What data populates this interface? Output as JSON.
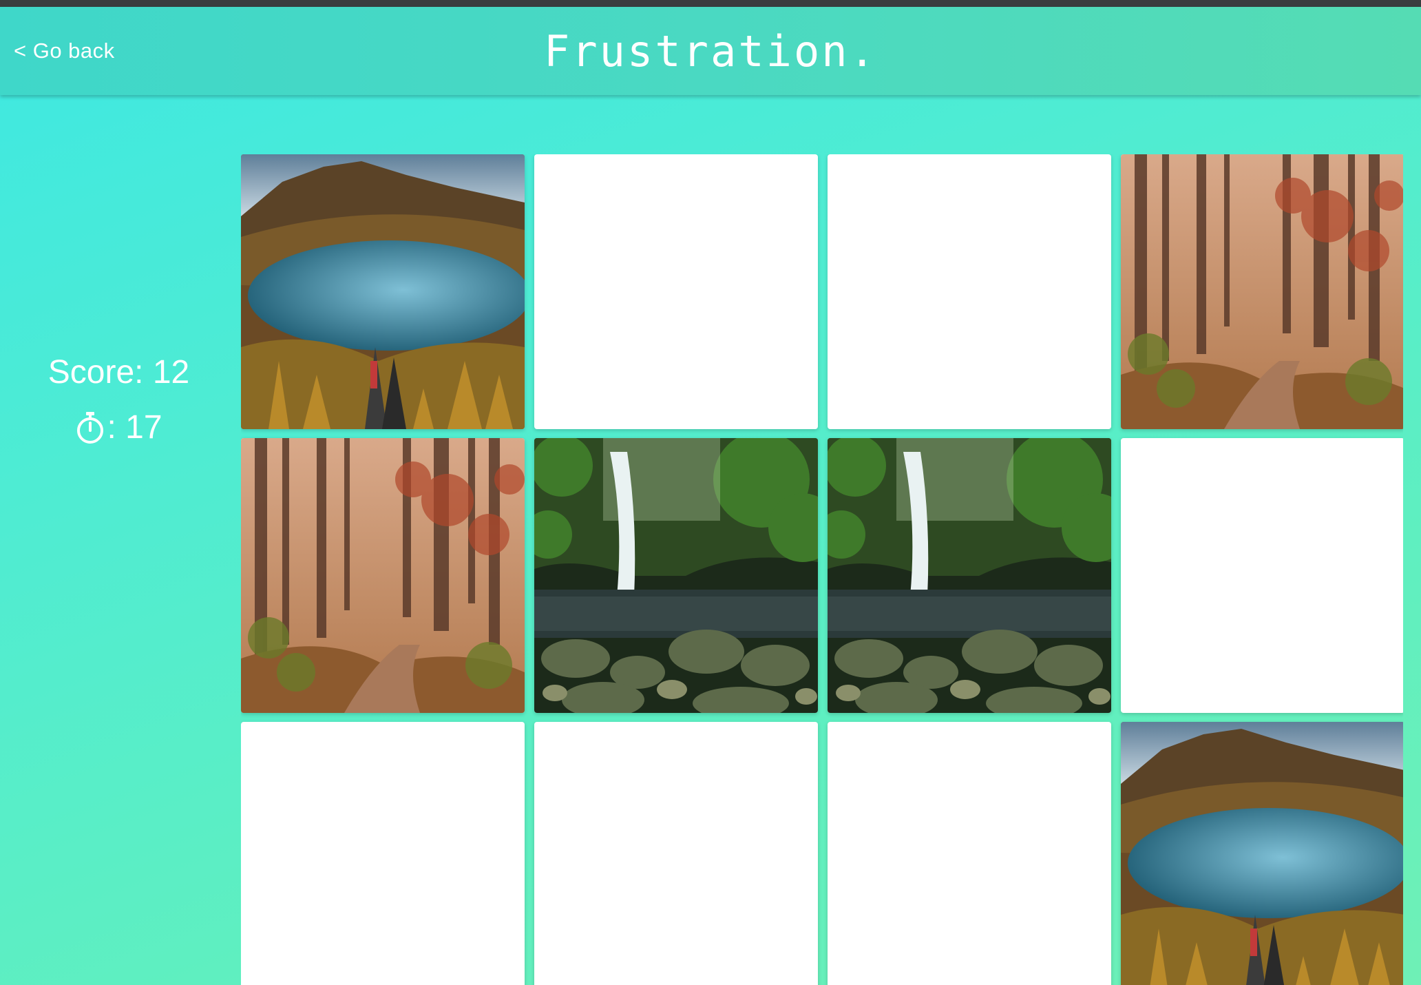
{
  "header": {
    "back_label": "< Go back",
    "title": "Frustration."
  },
  "stats": {
    "score_label": "Score: 12",
    "timer_label": ": 17",
    "timer_icon": "stopwatch-icon"
  },
  "board": {
    "rows": 3,
    "cols": 4,
    "cards": [
      {
        "state": "revealed",
        "image": "mountain-lake"
      },
      {
        "state": "hidden",
        "image": ""
      },
      {
        "state": "hidden",
        "image": ""
      },
      {
        "state": "revealed",
        "image": "autumn-forest"
      },
      {
        "state": "revealed",
        "image": "autumn-forest"
      },
      {
        "state": "revealed",
        "image": "waterfall"
      },
      {
        "state": "revealed",
        "image": "waterfall"
      },
      {
        "state": "hidden",
        "image": ""
      },
      {
        "state": "hidden",
        "image": ""
      },
      {
        "state": "hidden",
        "image": ""
      },
      {
        "state": "hidden",
        "image": ""
      },
      {
        "state": "revealed",
        "image": "mountain-lake"
      }
    ]
  },
  "colors": {
    "background_start": "#3ee8e2",
    "background_end": "#6ff0b6",
    "header": "#4ad9c2",
    "card_back": "#ffffff"
  }
}
